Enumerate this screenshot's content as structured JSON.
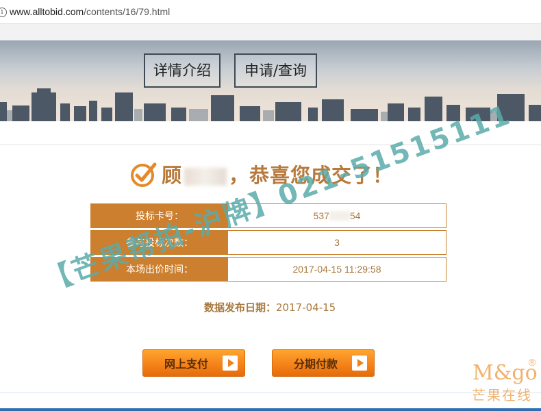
{
  "browser": {
    "info_icon": "info-icon",
    "url_domain": "www.alltobid.com",
    "url_path": "/contents/16/79.html"
  },
  "banner": {
    "buttons": [
      {
        "label": "详情介绍"
      },
      {
        "label": "申请/查询"
      }
    ]
  },
  "result": {
    "check_icon": "check-circle-icon",
    "greeting_prefix": "顾",
    "greeting_suffix": "，恭喜您成交了！",
    "rows": [
      {
        "label": "投标卡号：",
        "value_prefix": "537",
        "value_suffix": "54"
      },
      {
        "label": "参与投标次数：",
        "value": "3"
      },
      {
        "label": "本场出价时间：",
        "value": "2017-04-15 11:29:58"
      }
    ],
    "publish_label": "数据发布日期：",
    "publish_date": "2017-04-15"
  },
  "actions": {
    "online_pay": "网上支付",
    "installment": "分期付款"
  },
  "watermark": {
    "text": "【芒果帮拍-沪牌】021-51515111"
  },
  "logo": {
    "en": "M&go",
    "reg": "®",
    "cn": "芒果在线"
  },
  "colors": {
    "accent": "#cc7f2e",
    "text_gold": "#a8793e",
    "button_orange": "#f5831a",
    "watermark": "#5aaaaa"
  }
}
